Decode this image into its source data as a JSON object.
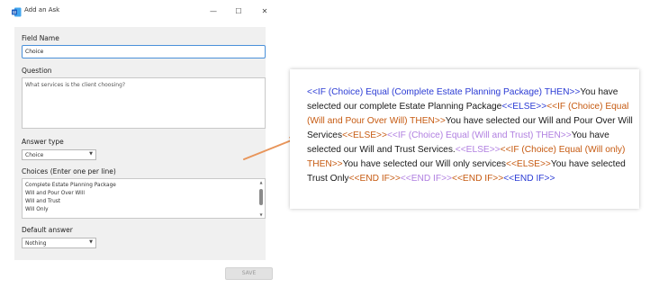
{
  "window": {
    "title": "Add an Ask",
    "minimize": "—",
    "maximize": "☐",
    "close": "✕"
  },
  "form": {
    "field_name_label": "Field Name",
    "field_name_value": "Choice",
    "question_label": "Question",
    "question_value": "What services is the client choosing?",
    "answer_type_label": "Answer type",
    "answer_type_value": "Choice",
    "choices_label": "Choices (Enter one per line)",
    "choices": [
      "Complete Estate Planning Package",
      "Will and Pour Over Will",
      "Will and Trust",
      "Will Only"
    ],
    "default_answer_label": "Default answer",
    "default_answer_value": "Nothing",
    "save_label": "SAVE"
  },
  "document": {
    "faint_header": "            ",
    "segments": [
      {
        "text": "<<IF (Choice) Equal (Complete Estate Planning Package) THEN>>",
        "style": "blue"
      },
      {
        "text": "You have selected our complete Estate Planning Package",
        "style": "black"
      },
      {
        "text": "<<ELSE>>",
        "style": "blue"
      },
      {
        "text": "<<IF (Choice) Equal (Will and Pour Over Will) THEN>>",
        "style": "orange"
      },
      {
        "text": "You have selected our Will and Pour Over Will Services",
        "style": "black"
      },
      {
        "text": "<<ELSE>>",
        "style": "orange"
      },
      {
        "text": "<<IF (Choice) Equal (Will and Trust) THEN>>",
        "style": "purple"
      },
      {
        "text": "You have selected our Will and Trust Services.",
        "style": "black"
      },
      {
        "text": "<<ELSE>>",
        "style": "purple"
      },
      {
        "text": "<<IF (Choice) Equal (Will only) THEN>>",
        "style": "orange"
      },
      {
        "text": "You have selected our Will only services",
        "style": "black"
      },
      {
        "text": "<<ELSE>>",
        "style": "orange"
      },
      {
        "text": "You have selected Trust Only",
        "style": "black"
      },
      {
        "text": "<<END IF>>",
        "style": "orange"
      },
      {
        "text": "<<END IF>>",
        "style": "purple"
      },
      {
        "text": "<<END IF>>",
        "style": "orange"
      },
      {
        "text": "<<END IF>>",
        "style": "blue"
      }
    ]
  },
  "colors": {
    "blue": "#2b3bd4",
    "orange": "#c65a11",
    "purple": "#b07fe0",
    "arrow": "#e8955a",
    "focus_border": "#4a90d9"
  }
}
